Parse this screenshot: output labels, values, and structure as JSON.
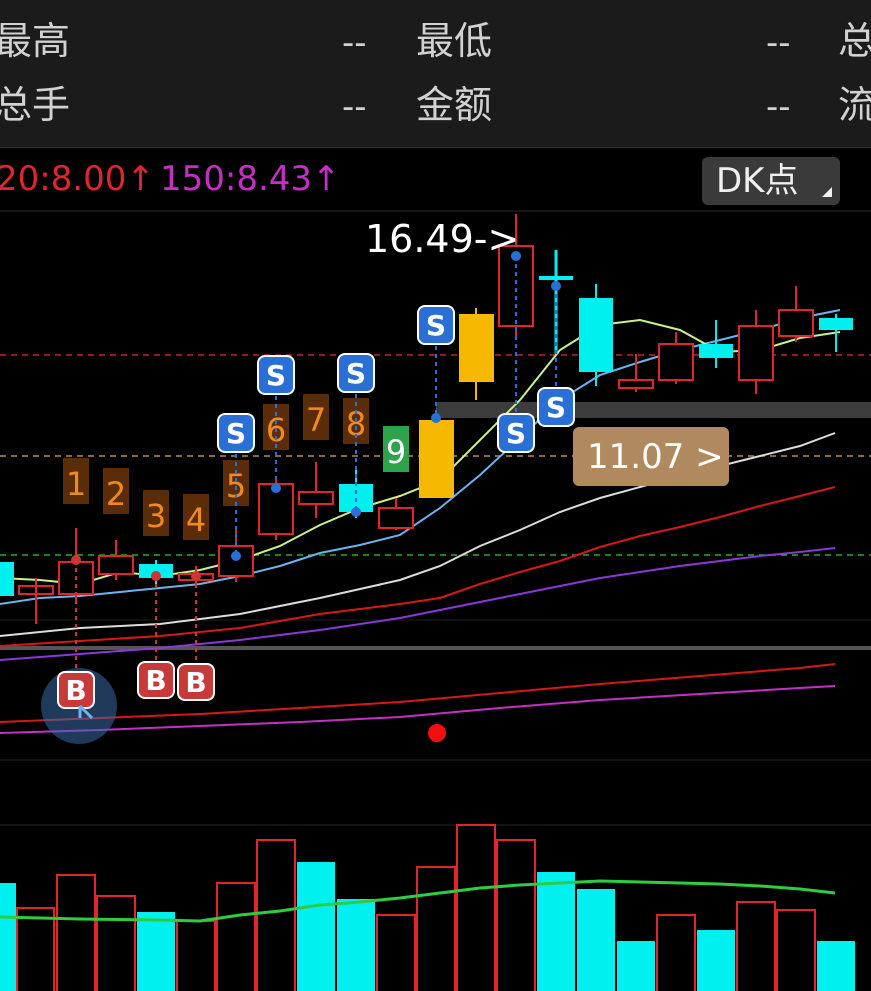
{
  "quote_panel": {
    "row1": {
      "label_left": "最高",
      "value_left": "--",
      "label_mid": "最低",
      "value_right": "--",
      "label_right": "总"
    },
    "row2": {
      "label_left": "总手",
      "value_left": "--",
      "label_mid": "金额",
      "value_right": "--",
      "label_right": "流"
    }
  },
  "ma_legend": {
    "ma120": {
      "text": "20:8.00↑",
      "color": "#e0262b"
    },
    "ma150": {
      "text": "150:8.43↑",
      "color": "#c62fc6"
    }
  },
  "dk_button": {
    "label": "DK点"
  },
  "markers": {
    "high_label": "16.49->",
    "price_tag": "11.07 >",
    "sell_label": "S",
    "buy_label": "B",
    "nine_count": [
      "1",
      "2",
      "3",
      "4",
      "5",
      "6",
      "7",
      "8",
      "9"
    ]
  },
  "colors": {
    "up": "#e0262b",
    "down": "#00f0f0",
    "special": "#f6b800",
    "ma5": "#c8f28c",
    "ma10": "#6ab4f0",
    "ma20": "#dcdcdc",
    "ma60": "#d81818",
    "ma90": "#8a38d8"
  },
  "chart_data": {
    "type": "candlestick",
    "candles": [
      {
        "o": 0,
        "h": 0,
        "l": 0,
        "c": 0,
        "kind": "down"
      },
      {
        "kind": "up"
      },
      {
        "kind": "up"
      },
      {
        "kind": "up"
      },
      {
        "kind": "down"
      },
      {
        "kind": "up"
      },
      {
        "kind": "up"
      },
      {
        "kind": "up"
      },
      {
        "kind": "up"
      },
      {
        "kind": "down"
      },
      {
        "kind": "up"
      },
      {
        "kind": "special"
      },
      {
        "kind": "special"
      },
      {
        "kind": "up"
      },
      {
        "kind": "down"
      },
      {
        "kind": "down"
      },
      {
        "kind": "up"
      },
      {
        "kind": "up"
      },
      {
        "kind": "down"
      },
      {
        "kind": "up"
      },
      {
        "kind": "up"
      },
      {
        "kind": "down"
      }
    ],
    "price_lines": {
      "high": "16.49",
      "tag": "11.07"
    }
  },
  "volume_bars": {
    "kinds": [
      "down",
      "up",
      "up",
      "up",
      "down",
      "up",
      "up",
      "up",
      "down",
      "down",
      "up",
      "up",
      "up",
      "up",
      "down",
      "down",
      "down",
      "up",
      "down",
      "up",
      "up",
      "down"
    ]
  }
}
